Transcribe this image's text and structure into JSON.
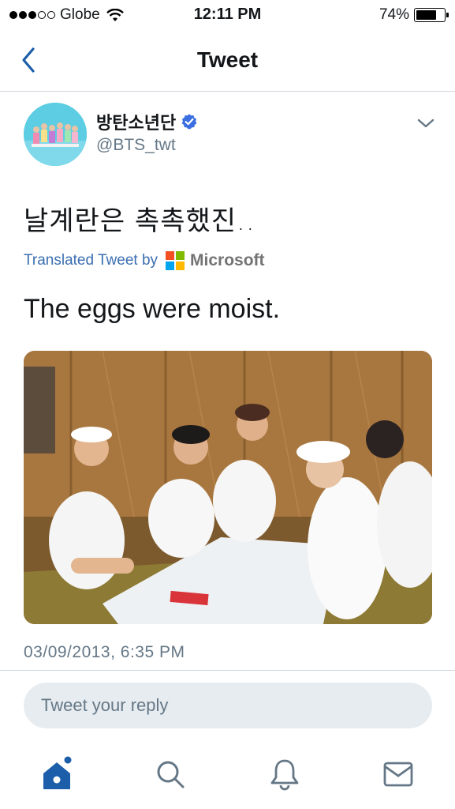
{
  "status_bar": {
    "signal_strength": 3,
    "signal_max": 5,
    "carrier": "Globe",
    "time": "12:11 PM",
    "battery_percent": "74%",
    "battery_level": 0.74
  },
  "header": {
    "title": "Tweet",
    "back_icon": "chevron-left-icon"
  },
  "tweet": {
    "display_name": "방탄소년단",
    "verified": true,
    "handle": "@BTS_twt",
    "text": "날계란은 촉촉했진..",
    "translated_by_label": "Translated Tweet by",
    "translator": "Microsoft",
    "translation": "The eggs were moist.",
    "timestamp": "03/09/2013, 6:35 PM"
  },
  "reply": {
    "placeholder": "Tweet your reply"
  },
  "tabs": [
    {
      "name": "home",
      "icon": "home-icon",
      "active": true,
      "has_notification_dot": true
    },
    {
      "name": "search",
      "icon": "search-icon",
      "active": false
    },
    {
      "name": "notifications",
      "icon": "bell-icon",
      "active": false
    },
    {
      "name": "messages",
      "icon": "mail-icon",
      "active": false
    }
  ],
  "colors": {
    "accent": "#1c5ea9",
    "link": "#3b6eb1",
    "muted": "#657786",
    "verified": "#3b6ee0",
    "ms_red": "#f25022",
    "ms_green": "#7fba00",
    "ms_blue": "#00a4ef",
    "ms_yellow": "#ffb900"
  }
}
